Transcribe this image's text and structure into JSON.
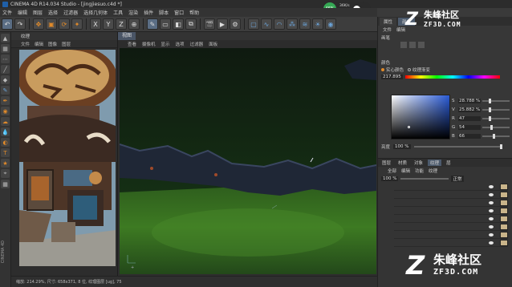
{
  "window": {
    "title": "CINEMA 4D R14.034 Studio - [jingjiesuo.c4d *]"
  },
  "menubar": {
    "items": [
      "文件",
      "编辑",
      "图层",
      "选择",
      "过滤器",
      "选择几何体",
      "工具",
      "渲染",
      "插件",
      "脚本",
      "窗口",
      "帮助"
    ]
  },
  "toolbar": {
    "mode_label": "1"
  },
  "perf": {
    "percent": "46%",
    "up": "36K/s",
    "down": "6.6K/s"
  },
  "ref_panel": {
    "tab": "纹理",
    "menu": [
      "文件",
      "编辑",
      "图像",
      "图层"
    ],
    "status": "缩放: 214.29%, 尺寸: 658x371, 8 位, 纹理图层 [ug], 75"
  },
  "viewport": {
    "tab": "视图",
    "menu": [
      "查看",
      "摄像机",
      "显示",
      "选项",
      "过滤器",
      "面板"
    ]
  },
  "right_panel": {
    "top_tabs": [
      "属性",
      "颜色"
    ],
    "menu": [
      "文件",
      "编辑"
    ],
    "brush_label": "画笔",
    "color_section": "颜色",
    "color_modes": [
      "实心颜色",
      "纹理渐变"
    ],
    "hex_value": "217.895",
    "sliders": [
      {
        "label": "S",
        "value": "28.788 %"
      },
      {
        "label": "V",
        "value": "25.882 %"
      },
      {
        "label": "R",
        "value": "47"
      },
      {
        "label": "G",
        "value": "54"
      },
      {
        "label": "B",
        "value": "66"
      }
    ],
    "brightness_label": "亮度",
    "brightness_value": "100 %",
    "color_hex": {
      "accent": "#e08a2a",
      "selection": "#4c5a6c"
    }
  },
  "layers_panel": {
    "tabs": [
      "图层",
      "材质",
      "对象",
      "纹理",
      "层"
    ],
    "menu": [
      "全部",
      "编辑",
      "功能",
      "纹理"
    ],
    "opacity": "100 %",
    "blend_mode": "正常",
    "rows": 8
  },
  "watermark": {
    "top_cn": "朱峰社区",
    "top_en": "ZF3D.COM",
    "bottom_cn": "朱峰社区",
    "bottom_en": "ZF3D.COM"
  },
  "sidebar_text": "CINEMA 4D"
}
